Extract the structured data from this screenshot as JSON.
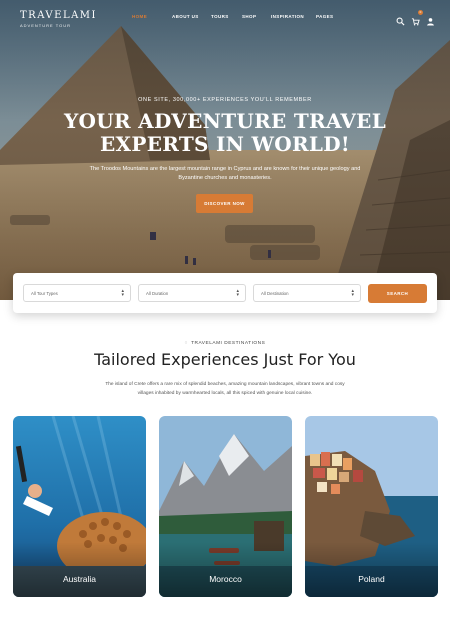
{
  "brand": {
    "name": "TRAVELAMI",
    "tagline": "ADVENTURE TOUR"
  },
  "nav": {
    "items": [
      {
        "label": "HOME",
        "active": true
      },
      {
        "label": "ABOUT US"
      },
      {
        "label": "TOURS"
      },
      {
        "label": "SHOP"
      },
      {
        "label": "INSPIRATION"
      },
      {
        "label": "PAGES"
      }
    ],
    "icons": [
      "search-icon",
      "cart-icon",
      "user-icon"
    ],
    "cart_count": "0"
  },
  "hero": {
    "eyebrow": "ONE SITE, 300,000+ EXPERIENCES YOU'LL REMEMBER",
    "title": "YOUR ADVENTURE TRAVEL EXPERTS IN WORLD!",
    "description": "The Troodos Mountains are the largest mountain range in Cyprus and are known for their unique geology and Byzantine churches and monasteries.",
    "button": "DISCOVER NOW"
  },
  "search": {
    "type_placeholder": "All Tour Types",
    "duration_placeholder": "All Duration",
    "destination_placeholder": "All Destination",
    "button": "SEARCH"
  },
  "destinations": {
    "eyebrow": "TRAVELAMI DESTINATIONS",
    "title": "Tailored Experiences Just For You",
    "description": "The island of Crete offers a rare mix of splendid beaches, amazing mountain landscapes, vibrant towns and cosy villages inhabited by warmhearted locals, all this spiced with genuine local cuisine.",
    "cards": [
      {
        "label": "Australia"
      },
      {
        "label": "Morocco"
      },
      {
        "label": "Poland"
      }
    ]
  },
  "colors": {
    "accent": "#d77b35"
  }
}
